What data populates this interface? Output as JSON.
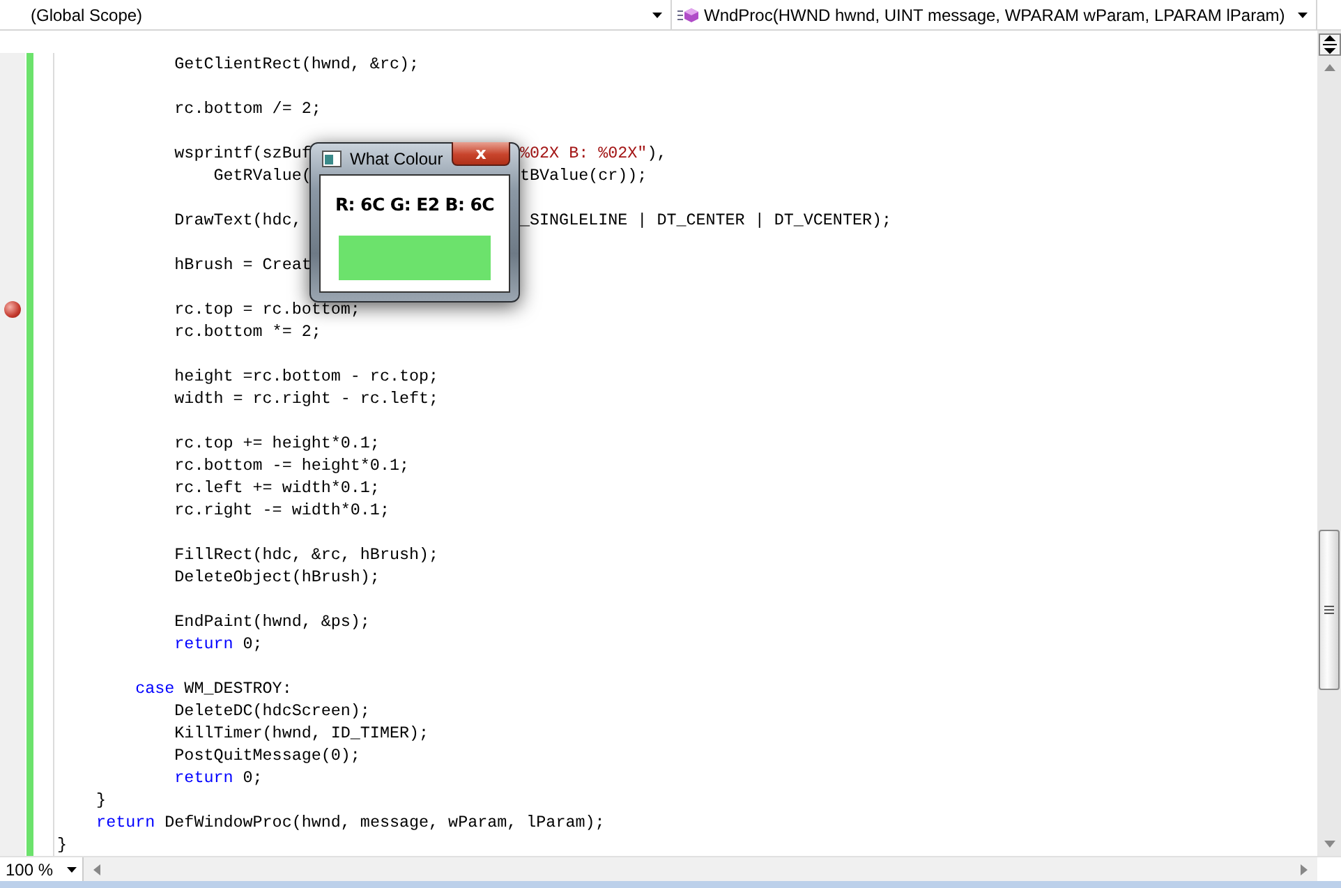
{
  "navigation_bar": {
    "scope": "(Global Scope)",
    "member": "WndProc(HWND hwnd, UINT message, WPARAM wParam, LPARAM lParam)"
  },
  "code_lines": [
    {
      "breakpoint": false,
      "left": [
        {
          "kind": "plain",
          "text": "            GetClientRect(hwnd, &rc);"
        }
      ]
    },
    {
      "breakpoint": false
    },
    {
      "breakpoint": false,
      "left": [
        {
          "kind": "plain",
          "text": "            rc.bottom /= 2;"
        }
      ]
    },
    {
      "breakpoint": false
    },
    {
      "breakpoint": false,
      "left": [
        {
          "kind": "plain",
          "text": "            wsprintf(szBuf"
        }
      ],
      "right": [
        {
          "kind": "string",
          "text": "%02X B: %02X\""
        },
        {
          "kind": "plain",
          "text": "),"
        }
      ]
    },
    {
      "breakpoint": false,
      "left": [
        {
          "kind": "plain",
          "text": "                GetRValue("
        }
      ],
      "right": [
        {
          "kind": "plain",
          "text": "tBValue(cr));"
        }
      ]
    },
    {
      "breakpoint": false
    },
    {
      "breakpoint": false,
      "left": [
        {
          "kind": "plain",
          "text": "            DrawText(hdc,"
        }
      ],
      "right": [
        {
          "kind": "plain",
          "text": "_SINGLELINE | DT_CENTER | DT_VCENTER);"
        }
      ]
    },
    {
      "breakpoint": false
    },
    {
      "breakpoint": false,
      "left": [
        {
          "kind": "plain",
          "text": "            hBrush = Creat"
        }
      ]
    },
    {
      "breakpoint": false
    },
    {
      "breakpoint": true,
      "left": [
        {
          "kind": "plain",
          "text": "            rc.top = rc.bottom;"
        }
      ]
    },
    {
      "breakpoint": false,
      "left": [
        {
          "kind": "plain",
          "text": "            rc.bottom *= 2;"
        }
      ]
    },
    {
      "breakpoint": false
    },
    {
      "breakpoint": false,
      "left": [
        {
          "kind": "plain",
          "text": "            height =rc.bottom - rc.top;"
        }
      ]
    },
    {
      "breakpoint": false,
      "left": [
        {
          "kind": "plain",
          "text": "            width = rc.right - rc.left;"
        }
      ]
    },
    {
      "breakpoint": false
    },
    {
      "breakpoint": false,
      "left": [
        {
          "kind": "plain",
          "text": "            rc.top += height*0.1;"
        }
      ]
    },
    {
      "breakpoint": false,
      "left": [
        {
          "kind": "plain",
          "text": "            rc.bottom -= height*0.1;"
        }
      ]
    },
    {
      "breakpoint": false,
      "left": [
        {
          "kind": "plain",
          "text": "            rc.left += width*0.1;"
        }
      ]
    },
    {
      "breakpoint": false,
      "left": [
        {
          "kind": "plain",
          "text": "            rc.right -= width*0.1;"
        }
      ]
    },
    {
      "breakpoint": false
    },
    {
      "breakpoint": false,
      "left": [
        {
          "kind": "plain",
          "text": "            FillRect(hdc, &rc, hBrush);"
        }
      ]
    },
    {
      "breakpoint": false,
      "left": [
        {
          "kind": "plain",
          "text": "            DeleteObject(hBrush);"
        }
      ]
    },
    {
      "breakpoint": false
    },
    {
      "breakpoint": false,
      "left": [
        {
          "kind": "plain",
          "text": "            EndPaint(hwnd, &ps);"
        }
      ]
    },
    {
      "breakpoint": false,
      "left": [
        {
          "kind": "keyword",
          "text": "            return"
        },
        {
          "kind": "plain",
          "text": " 0;"
        }
      ]
    },
    {
      "breakpoint": false
    },
    {
      "breakpoint": false,
      "left": [
        {
          "kind": "keyword",
          "text": "        case"
        },
        {
          "kind": "plain",
          "text": " WM_DESTROY:"
        }
      ]
    },
    {
      "breakpoint": false,
      "left": [
        {
          "kind": "plain",
          "text": "            DeleteDC(hdcScreen);"
        }
      ]
    },
    {
      "breakpoint": false,
      "left": [
        {
          "kind": "plain",
          "text": "            KillTimer(hwnd, ID_TIMER);"
        }
      ]
    },
    {
      "breakpoint": false,
      "left": [
        {
          "kind": "plain",
          "text": "            PostQuitMessage(0);"
        }
      ]
    },
    {
      "breakpoint": false,
      "left": [
        {
          "kind": "keyword",
          "text": "            return"
        },
        {
          "kind": "plain",
          "text": " 0;"
        }
      ]
    },
    {
      "breakpoint": false,
      "left": [
        {
          "kind": "plain",
          "text": "    }"
        }
      ]
    },
    {
      "breakpoint": false,
      "left": [
        {
          "kind": "keyword",
          "text": "    return"
        },
        {
          "kind": "plain",
          "text": " DefWindowProc(hwnd, message, wParam, lParam);"
        }
      ]
    },
    {
      "breakpoint": false,
      "left": [
        {
          "kind": "plain",
          "text": "}"
        }
      ]
    }
  ],
  "dialog": {
    "title": "What Colour",
    "close": "x",
    "reading": "R: 6C G: E2 B: 6C",
    "swatch": {
      "color": "#6ce26c"
    }
  },
  "zoom": "100 %"
}
